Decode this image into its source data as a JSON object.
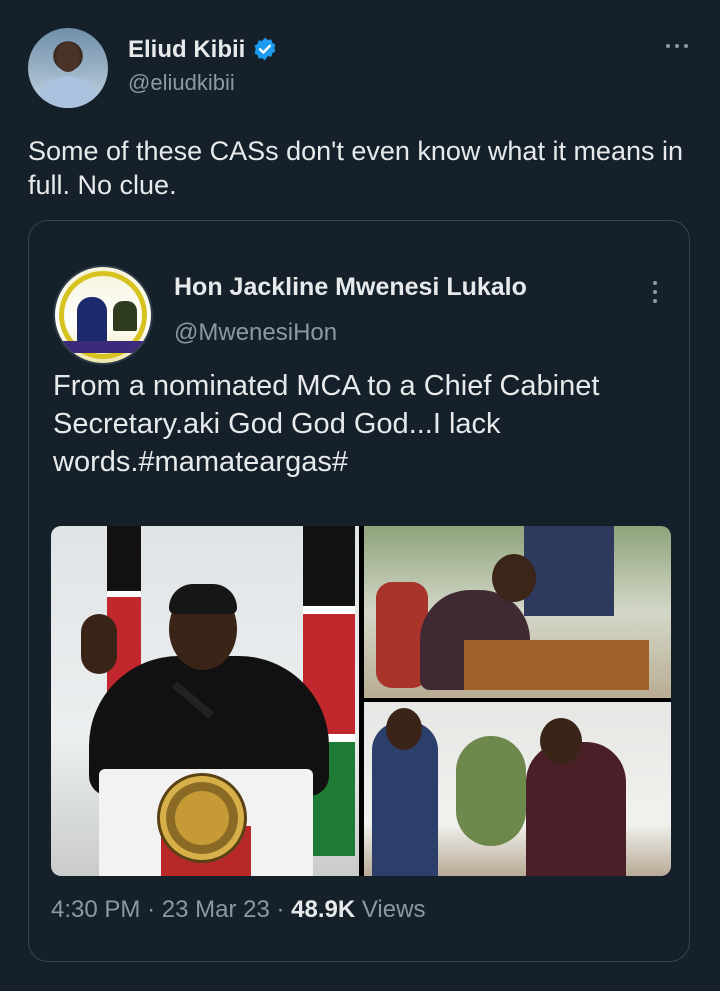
{
  "tweet": {
    "author_name": "Eliud Kibii",
    "author_handle": "@eliudkibii",
    "text": "Some of these CASs don't even know what it means in full. No clue."
  },
  "quoted_tweet": {
    "author_name": "Hon Jackline Mwenesi Lukalo",
    "author_handle": "@MwenesiHon",
    "text": "From a nominated MCA to a Chief Cabinet Secretary.aki God God God...I lack words.#mamateargas#",
    "time": "4:30 PM",
    "separator": "·",
    "date": "23 Mar 23",
    "views_count": "48.9K",
    "views_label": "Views"
  },
  "icons": [
    "verified-badge-icon",
    "more-options-icon",
    "more-options-vertical-icon"
  ],
  "colors": {
    "background": "#15202b",
    "text_primary": "#e7e9ea",
    "text_secondary": "#8b98a5",
    "border": "#38444d",
    "verified_blue": "#1d9bf0"
  }
}
